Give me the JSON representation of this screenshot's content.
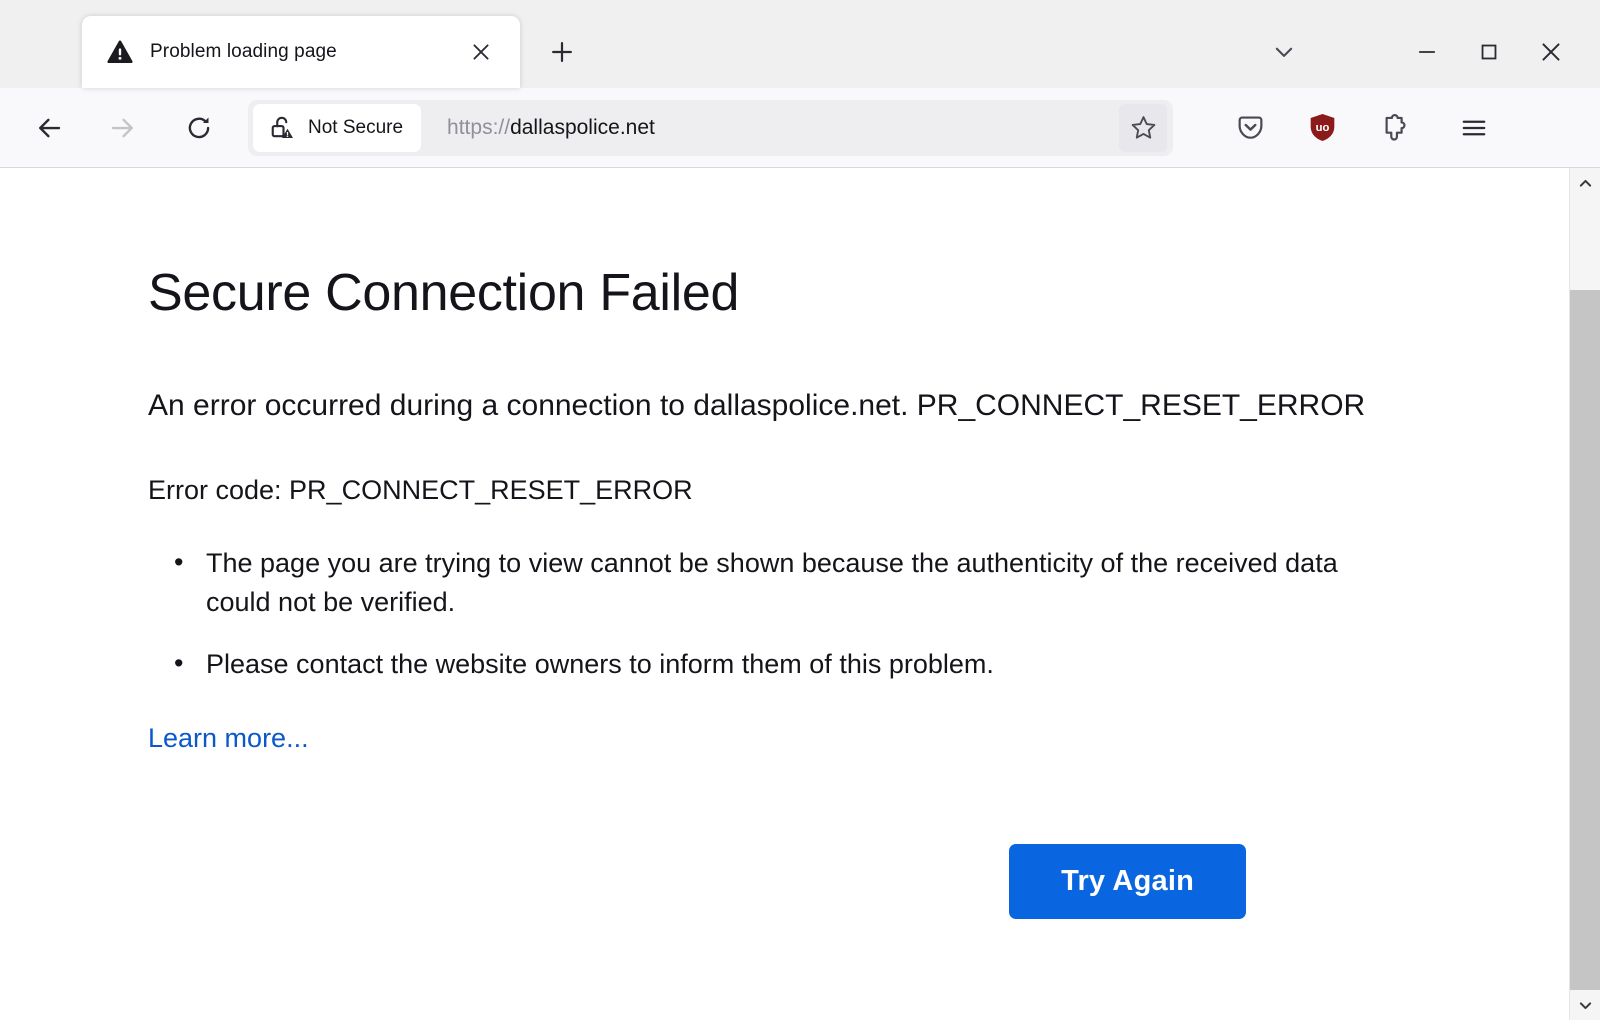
{
  "window": {
    "tablist_icon": "chevron-down-icon",
    "minimize_label": "—",
    "maximize_label": "▢",
    "close_label": "✕"
  },
  "tab": {
    "favicon": "warning-triangle-icon",
    "title": "Problem loading page",
    "close_icon": "close-icon",
    "new_tab_icon": "plus-icon"
  },
  "toolbar": {
    "back_icon": "back-arrow-icon",
    "forward_icon": "forward-arrow-icon",
    "reload_icon": "reload-icon",
    "bookmark_icon": "star-icon",
    "pocket_icon": "pocket-icon",
    "ublock_icon": "ublock-origin-shield-icon",
    "ublock_label": "uo",
    "extensions_icon": "puzzle-piece-icon",
    "menu_icon": "hamburger-menu-icon"
  },
  "urlbar": {
    "security_icon": "unlocked-padlock-warning-icon",
    "security_label": "Not Secure",
    "url_scheme": "https://",
    "url_host": "dallaspolice.net",
    "url_full": "https://dallaspolice.net"
  },
  "page": {
    "title": "Secure Connection Failed",
    "long_description": "An error occurred during a connection to dallaspolice.net. PR_CONNECT_RESET_ERROR",
    "error_code_line": "Error code: PR_CONNECT_RESET_ERROR",
    "bullets": [
      "The page you are trying to view cannot be shown because the authenticity of the received data could not be verified.",
      "Please contact the website owners to inform them of this problem."
    ],
    "learn_more": "Learn more...",
    "try_again": "Try Again"
  },
  "scrollbar": {
    "up_icon": "chevron-up-icon",
    "down_icon": "chevron-down-icon"
  },
  "colors": {
    "accent_button": "#0a66e0",
    "link": "#0a58ca",
    "ublock_red": "#8b1a1a",
    "chrome_bg": "#f9f9fb",
    "tabstrip_bg": "#f0f0f0"
  }
}
